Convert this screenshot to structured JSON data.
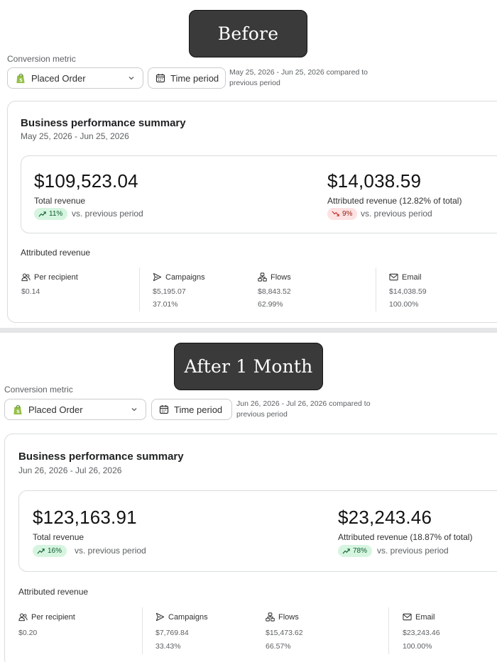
{
  "before": {
    "label": "Before",
    "conversion_metric_label": "Conversion metric",
    "metric_select": "Placed Order",
    "time_period_button": "Time period",
    "period_text": "May 25, 2026 - Jun 25, 2026 compared to previous period",
    "card_title": "Business performance summary",
    "card_date": "May 25, 2026 - Jun 25, 2026",
    "total_revenue": {
      "value": "$109,523.04",
      "label": "Total revenue",
      "change": "11%",
      "trend": "up",
      "vs": "vs. previous period"
    },
    "attributed_revenue": {
      "value": "$14,038.59",
      "label": "Attributed revenue (12.82% of total)",
      "change": "9%",
      "trend": "down",
      "vs": "vs. previous period"
    },
    "attributed_title": "Attributed revenue",
    "columns": [
      {
        "label": "Per recipient",
        "icon": "people-icon",
        "value": "$0.14",
        "pct": ""
      },
      {
        "label": "Campaigns",
        "icon": "send-icon",
        "value": "$5,195.07",
        "pct": "37.01%"
      },
      {
        "label": "Flows",
        "icon": "flows-icon",
        "value": "$8,843.52",
        "pct": "62.99%"
      },
      {
        "label": "Email",
        "icon": "mail-icon",
        "value": "$14,038.59",
        "pct": "100.00%"
      }
    ]
  },
  "after": {
    "label": "After 1 Month",
    "conversion_metric_label": "Conversion metric",
    "metric_select": "Placed Order",
    "time_period_button": "Time period",
    "period_text": "Jun 26, 2026 - Jul 26, 2026 compared to previous period",
    "card_title": "Business performance summary",
    "card_date": "Jun 26, 2026 - Jul 26, 2026",
    "total_revenue": {
      "value": "$123,163.91",
      "label": "Total revenue",
      "change": "16%",
      "trend": "up",
      "vs": "vs. previous period"
    },
    "attributed_revenue": {
      "value": "$23,243.46",
      "label": "Attributed revenue (18.87% of total)",
      "change": "78%",
      "trend": "up",
      "vs": "vs. previous period"
    },
    "attributed_title": "Attributed revenue",
    "columns": [
      {
        "label": "Per recipient",
        "icon": "people-icon",
        "value": "$0.20",
        "pct": ""
      },
      {
        "label": "Campaigns",
        "icon": "send-icon",
        "value": "$7,769.84",
        "pct": "33.43%"
      },
      {
        "label": "Flows",
        "icon": "flows-icon",
        "value": "$15,473.62",
        "pct": "66.57%"
      },
      {
        "label": "Email",
        "icon": "mail-icon",
        "value": "$23,243.46",
        "pct": "100.00%"
      }
    ]
  },
  "colors": {
    "positive_bg": "#d6f5e0",
    "positive_fg": "#0d5c2e",
    "negative_bg": "#fde1e3",
    "negative_fg": "#8e1f0b",
    "label_box": "#3a3a3a"
  }
}
